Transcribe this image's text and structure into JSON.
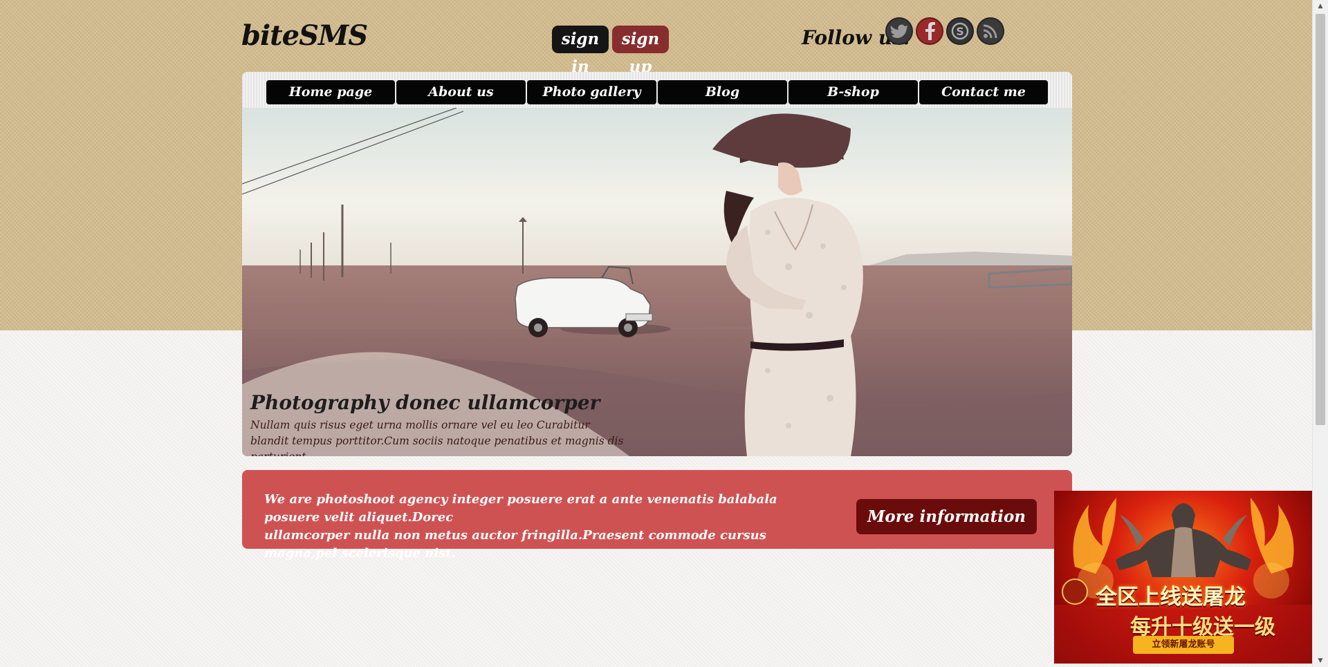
{
  "header": {
    "logo": "biteSMS",
    "auth": {
      "sign_in": "sign in",
      "sign_up": "sign up"
    },
    "follow_label": "Follow us:",
    "social": [
      "twitter-icon",
      "facebook-icon",
      "skype-icon",
      "rss-icon"
    ]
  },
  "nav": {
    "items": [
      "Home page",
      "About us",
      "Photo gallery",
      "Blog",
      "B-shop",
      "Contact me"
    ]
  },
  "hero": {
    "title": "Photography donec ullamcorper",
    "text_line1": "Nullam quis risus eget urna mollis ornare vel eu leo Curabitur",
    "text_line2": "blandit tempus porttitor.Cum sociis natoque penatibus et magnis dis parturient."
  },
  "info": {
    "text_line1": "We are photoshoot agency integer posuere erat a ante venenatis balabala posuere velit aliquet.Dorec",
    "text_line2": "ullamcorper nulla non metus auctor fringilla.Praesent commode cursus magna,pel scelerisque nist.",
    "button": "More information"
  },
  "ad": {
    "line1": "全区上线送屠龙",
    "line2": "每升十级送一级",
    "button": "立领新屠龙账号"
  },
  "colors": {
    "top_band": "#d4bc8e",
    "sign_in_bg": "#151515",
    "sign_up_bg": "#872d2d",
    "info_bg": "#cf5252",
    "more_btn_bg": "#6b0c0c"
  }
}
